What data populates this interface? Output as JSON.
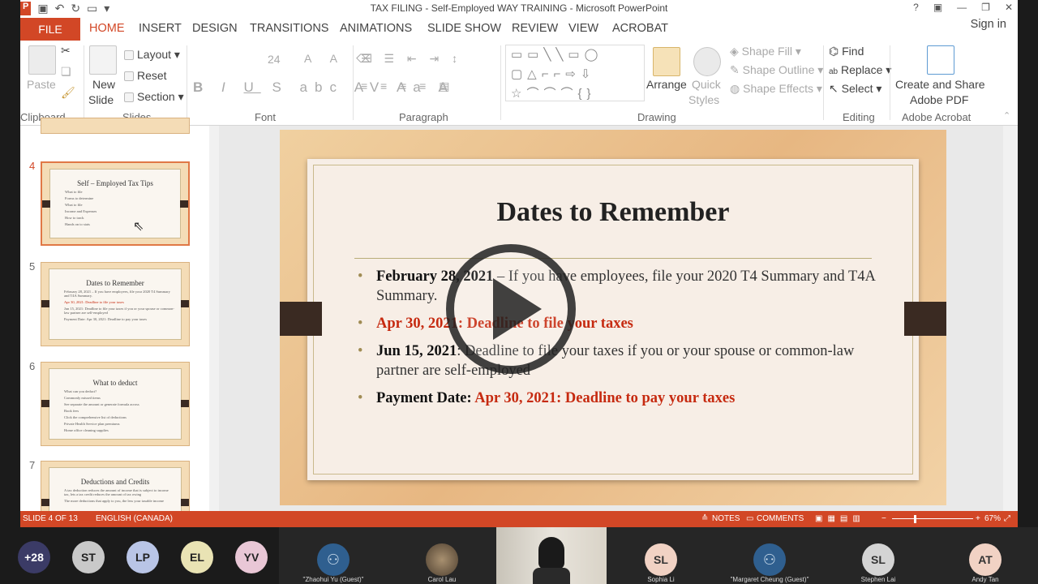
{
  "app": {
    "title": "TAX FILING - Self-Employed WAY TRAINING - Microsoft PowerPoint",
    "signin": "Sign in"
  },
  "tabs": [
    "FILE",
    "HOME",
    "INSERT",
    "DESIGN",
    "TRANSITIONS",
    "ANIMATIONS",
    "SLIDE SHOW",
    "REVIEW",
    "VIEW",
    "ACROBAT"
  ],
  "ribbon": {
    "paste": "Paste",
    "new_slide_1": "New",
    "new_slide_2": "Slide",
    "layout": "Layout",
    "reset": "Reset",
    "section": "Section",
    "font_size": "24",
    "arrange": "Arrange",
    "quick_styles_1": "Quick",
    "quick_styles_2": "Styles",
    "shape_fill": "Shape Fill",
    "shape_outline": "Shape Outline",
    "shape_effects": "Shape Effects",
    "find": "Find",
    "replace": "Replace",
    "select": "Select",
    "create_share_1": "Create and Share",
    "create_share_2": "Adobe PDF",
    "groups": {
      "clipboard": "Clipboard",
      "slides": "Slides",
      "font": "Font",
      "paragraph": "Paragraph",
      "drawing": "Drawing",
      "editing": "Editing",
      "acrobat": "Adobe Acrobat"
    }
  },
  "thumbs": [
    {
      "num": "4",
      "title": "Self – Employed Tax Tips",
      "lines": [
        "What to file",
        "Forms to determine",
        "What to file",
        "Income and Expenses",
        "How to track",
        "Hands on to stats"
      ]
    },
    {
      "num": "5",
      "title": "Dates to Remember",
      "lines": [
        "February 28, 2021 – If you have employees, file your 2020 T4 Summary and T4A Summary.",
        "Apr 30, 2021: Deadline to file your taxes",
        "Jun 15, 2021: Deadline to file your taxes if you or your spouse or common-law partner are self-employed",
        "Payment Date: Apr 30, 2021: Deadline to pay your taxes"
      ]
    },
    {
      "num": "6",
      "title": "What to deduct",
      "lines": [
        "What can you deduct?",
        "Commonly missed items",
        "See separate the amount or generate formula across",
        "Book fees",
        "Click the comprehensive list of deductions",
        "Private Health Service plan premiums",
        "Home office cleaning supplies"
      ]
    },
    {
      "num": "7",
      "title": "Deductions and Credits",
      "lines": [
        "A tax deduction reduces the amount of income that is subject to income tax, lets a tax credit reduces the amount of tax owing",
        "The more deductions that apply to you, the less your taxable income"
      ]
    }
  ],
  "slide": {
    "title": "Dates to Remember",
    "b1_bold": "February 28, 2021",
    "b1_rest": " – If you have employees, file your 2020 T4 Summary and T4A Summary.",
    "b2": "Apr 30, 2021: Deadline to file your taxes",
    "b3_bold": "Jun 15, 2021",
    "b3_rest": ": Deadline to file your taxes if you or your spouse or common-law partner are self-employed",
    "b4_bold": "Payment Date: ",
    "b4_red": "Apr 30, 2021: Deadline to pay your taxes"
  },
  "status": {
    "slide": "SLIDE 4 OF 13",
    "lang": "ENGLISH (CANADA)",
    "notes": "NOTES",
    "comments": "COMMENTS",
    "zoom": "67%"
  },
  "participants": [
    {
      "initials": "+28",
      "color": "#3b3b66"
    },
    {
      "initials": "ST",
      "color": "#c9c9c9"
    },
    {
      "initials": "LP",
      "color": "#b9c5e6"
    },
    {
      "initials": "EL",
      "color": "#e9e3b4"
    },
    {
      "initials": "YV",
      "color": "#e9c7d6"
    }
  ],
  "tiles": [
    {
      "name": "\"Zhaohui Yu (Guest)\"",
      "initials": "",
      "color": "#2f5f8f"
    },
    {
      "name": "Carol Lau",
      "initials": "",
      "color": "#7a6a4e"
    },
    {
      "name": "",
      "initials": "",
      "color": ""
    },
    {
      "name": "Sophia Li",
      "initials": "SL",
      "color": "#f1d2c4"
    },
    {
      "name": "\"Margaret Cheung (Guest)\"",
      "initials": "",
      "color": "#2f5f8f"
    },
    {
      "name": "Stephen Lai",
      "initials": "SL",
      "color": "#d4d4d4"
    },
    {
      "name": "Andy Tan",
      "initials": "AT",
      "color": "#f1d2c4"
    }
  ]
}
